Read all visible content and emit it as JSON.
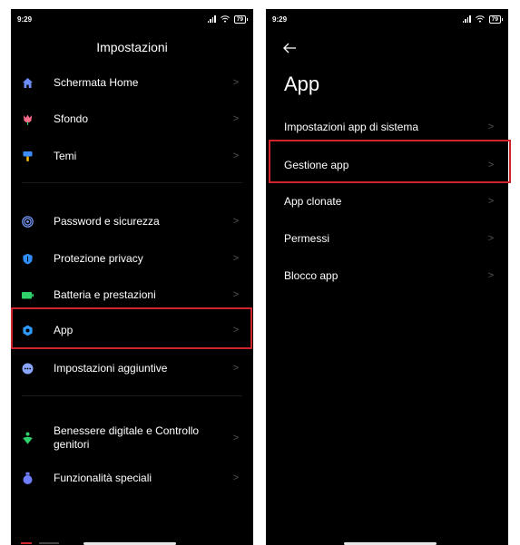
{
  "left_screen": {
    "status": {
      "time": "9:29",
      "battery": "79"
    },
    "title": "Impostazioni",
    "items": [
      {
        "label": "Schermata Home",
        "icon": "home-icon"
      },
      {
        "label": "Sfondo",
        "icon": "tulip-icon"
      },
      {
        "label": "Temi",
        "icon": "paintbrush-icon"
      },
      {
        "label": "Password e sicurezza",
        "icon": "fingerprint-icon"
      },
      {
        "label": "Protezione privacy",
        "icon": "shield-icon"
      },
      {
        "label": "Batteria e prestazioni",
        "icon": "battery-icon"
      },
      {
        "label": "App",
        "icon": "gear-icon"
      },
      {
        "label": "Impostazioni aggiuntive",
        "icon": "more-dots-icon"
      },
      {
        "label": "Benessere digitale e Controllo genitori",
        "icon": "wellbeing-icon"
      },
      {
        "label": "Funzionalità speciali",
        "icon": "potion-icon"
      }
    ],
    "highlighted_item": "App"
  },
  "right_screen": {
    "status": {
      "time": "9:29",
      "battery": "79"
    },
    "title": "App",
    "items": [
      {
        "label": "Impostazioni app di sistema"
      },
      {
        "label": "Gestione app"
      },
      {
        "label": "App clonate"
      },
      {
        "label": "Permessi"
      },
      {
        "label": "Blocco app"
      }
    ],
    "highlighted_item": "Gestione app"
  },
  "colors": {
    "background": "#000000",
    "text": "#ffffff",
    "chevron": "#555555",
    "highlight": "#d0232b",
    "icon_home": "#6f8cff",
    "icon_wallpaper": "#ff6b8a",
    "icon_theme": "#3f8cff",
    "icon_password": "#7a9cff",
    "icon_privacy": "#2f8fff",
    "icon_battery": "#2fd16a",
    "icon_app": "#2f9bff",
    "icon_more": "#8aa6ff",
    "icon_wellbeing": "#2fd16a",
    "icon_special": "#6f7dff"
  },
  "icons": {
    "chevron": "chevron-right-icon",
    "back": "back-arrow-icon",
    "wifi": "wifi-icon",
    "signal": "signal-icon",
    "battery_status": "battery-status-icon"
  }
}
